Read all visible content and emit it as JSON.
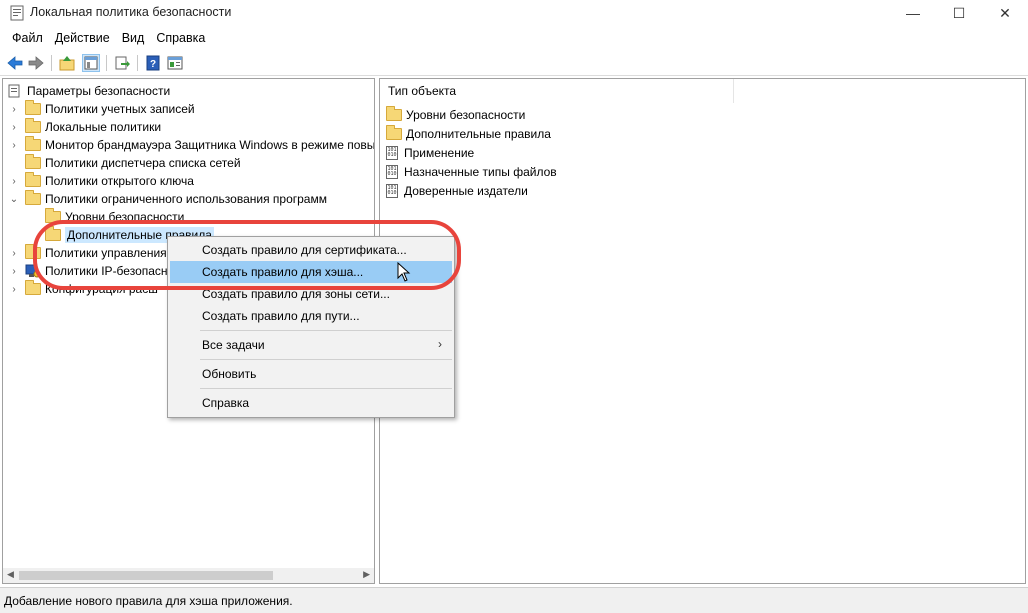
{
  "window": {
    "title": "Локальная политика безопасности",
    "controls": {
      "minimize": "—",
      "maximize": "☐",
      "close": "✕"
    }
  },
  "menubar": {
    "items": [
      "Файл",
      "Действие",
      "Вид",
      "Справка"
    ]
  },
  "toolbar": {
    "buttons": [
      "back-icon",
      "forward-icon",
      "up-icon",
      "show-hide-tree-icon",
      "export-icon",
      "help-icon",
      "properties-icon"
    ]
  },
  "tree": {
    "root": "Параметры безопасности",
    "items": [
      "Политики учетных записей",
      "Локальные политики",
      "Монитор брандмауэра Защитника Windows в режиме повы",
      "Политики диспетчера списка сетей",
      "Политики открытого ключа",
      "Политики ограниченного использования программ",
      "Уровни безопасности",
      "Дополнительные правила",
      "Политики управления",
      "Политики IP-безопасно",
      "Конфигурация расш"
    ]
  },
  "right_pane": {
    "column_header": "Тип объекта",
    "items": [
      "Уровни безопасности",
      "Дополнительные правила",
      "Применение",
      "Назначенные типы файлов",
      "Доверенные издатели"
    ]
  },
  "context_menu": {
    "items": [
      "Создать правило для сертификата...",
      "Создать правило для хэша...",
      "Создать правило для зоны сети...",
      "Создать правило для пути...",
      "Все задачи",
      "Обновить",
      "Справка"
    ],
    "submenu_arrow": "›"
  },
  "statusbar": {
    "text": "Добавление нового правила для хэша приложения."
  },
  "colors": {
    "highlight": "#99ccf5",
    "selection": "#cce8ff",
    "annotation_ring": "#e8443c"
  }
}
